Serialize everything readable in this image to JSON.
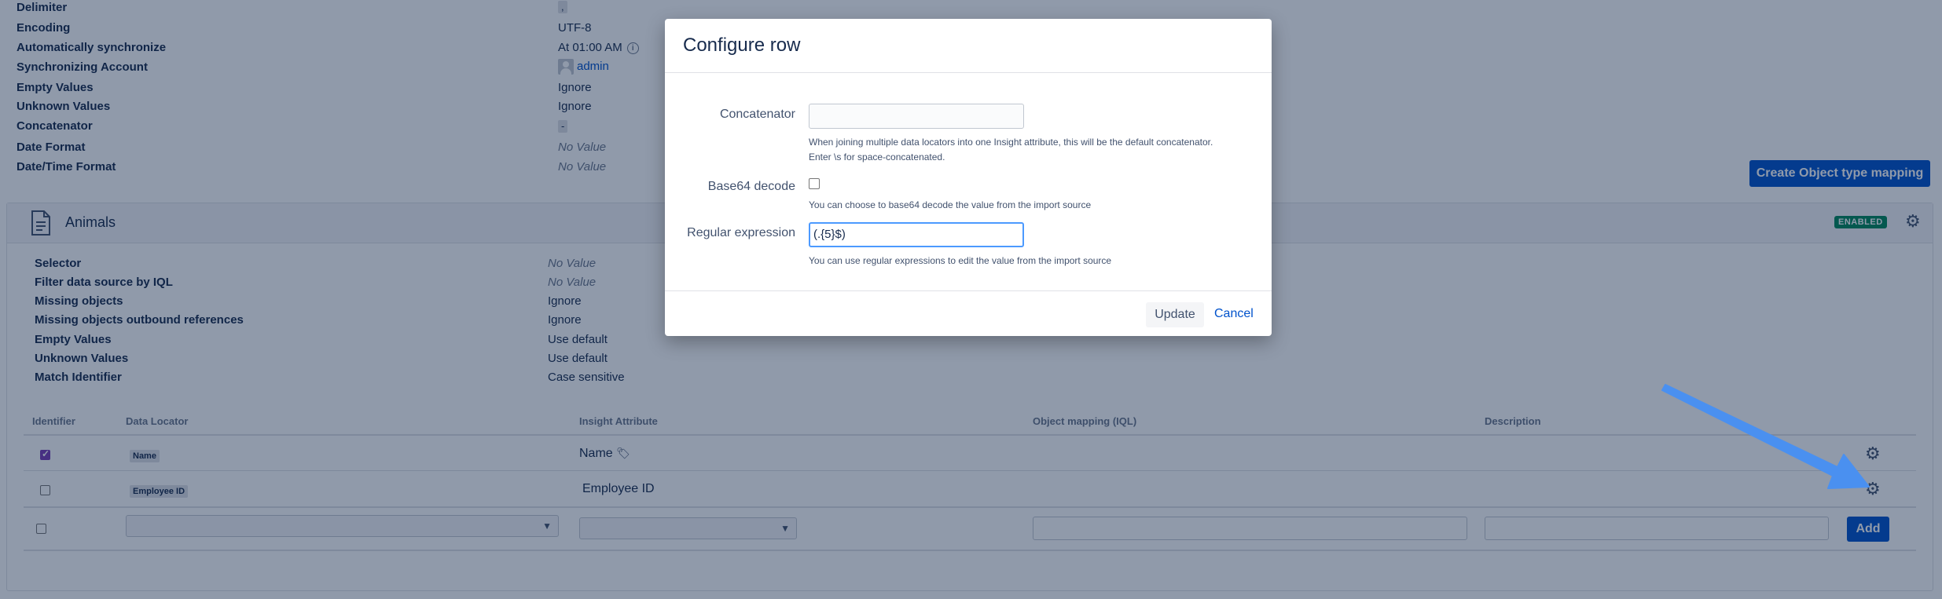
{
  "settings": {
    "rows": [
      {
        "label": "Delimiter",
        "value": ","
      },
      {
        "label": "Encoding",
        "value": "UTF-8"
      },
      {
        "label": "Automatically synchronize",
        "value": "At 01:00 AM"
      },
      {
        "label": "Synchronizing Account",
        "value": "admin"
      },
      {
        "label": "Empty Values",
        "value": "Ignore"
      },
      {
        "label": "Unknown Values",
        "value": "Ignore"
      },
      {
        "label": "Concatenator",
        "value": "-"
      },
      {
        "label": "Date Format",
        "value": "No Value"
      },
      {
        "label": "Date/Time Format",
        "value": "No Value"
      }
    ]
  },
  "create_mapping_button": "Create Object type mapping",
  "panel": {
    "title": "Animals",
    "status": "ENABLED",
    "props": [
      {
        "label": "Selector",
        "value": "No Value"
      },
      {
        "label": "Filter data source by IQL",
        "value": "No Value"
      },
      {
        "label": "Missing objects",
        "value": "Ignore"
      },
      {
        "label": "Missing objects outbound references",
        "value": "Ignore"
      },
      {
        "label": "Empty Values",
        "value": "Use default"
      },
      {
        "label": "Unknown Values",
        "value": "Use default"
      },
      {
        "label": "Match Identifier",
        "value": "Case sensitive"
      }
    ],
    "table": {
      "headers": [
        "Identifier",
        "Data Locator",
        "Insight Attribute",
        "Object mapping (IQL)",
        "Description"
      ],
      "rows": [
        {
          "identifier": true,
          "locator": "Name",
          "attribute": "Name"
        },
        {
          "identifier": false,
          "locator": "Employee ID",
          "attribute": "Employee ID"
        }
      ],
      "add_button": "Add"
    }
  },
  "modal": {
    "title": "Configure row",
    "fields": {
      "concatenator_label": "Concatenator",
      "concatenator_value": "",
      "concatenator_help1": "When joining multiple data locators into one Insight attribute, this will be the default concatenator.",
      "concatenator_help2": "Enter \\s for space-concatenated.",
      "base64_label": "Base64 decode",
      "base64_help": "You can choose to base64 decode the value from the import source",
      "regex_label": "Regular expression",
      "regex_value": "(.{5}$)",
      "regex_help": "You can use regular expressions to edit the value from the import source"
    },
    "update_button": "Update",
    "cancel_link": "Cancel"
  },
  "colors": {
    "primary": "#0052cc",
    "enabled": "#00875a",
    "overlay": "rgba(9,30,66,0.45)",
    "arrow": "#4a90f0"
  }
}
